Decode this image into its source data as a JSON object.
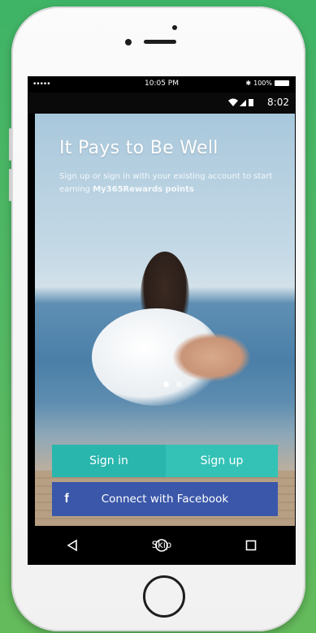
{
  "device": {
    "ios_status": {
      "signal": "•••••",
      "time": "10:05 PM",
      "battery": "100%"
    },
    "android_status": {
      "time": "8:02"
    }
  },
  "app": {
    "title": "It Pays to Be Well",
    "subtitle_prefix": "Sign up or sign in with your existing account to start earning ",
    "subtitle_bold": "My365Rewards points",
    "carousel": {
      "current": 1,
      "total": 2
    },
    "buttons": {
      "sign_in": "Sign in",
      "sign_up": "Sign up",
      "facebook": "Connect with Facebook",
      "facebook_icon": "f"
    },
    "skip": "Skip"
  },
  "nav": {
    "back_icon": "back-triangle-icon",
    "home_icon": "home-circle-icon",
    "recents_icon": "recents-square-icon"
  },
  "colors": {
    "background": "#4cb563",
    "sign_in": "#29b6ad",
    "sign_up": "#34c2b6",
    "facebook": "#3a57a9"
  }
}
